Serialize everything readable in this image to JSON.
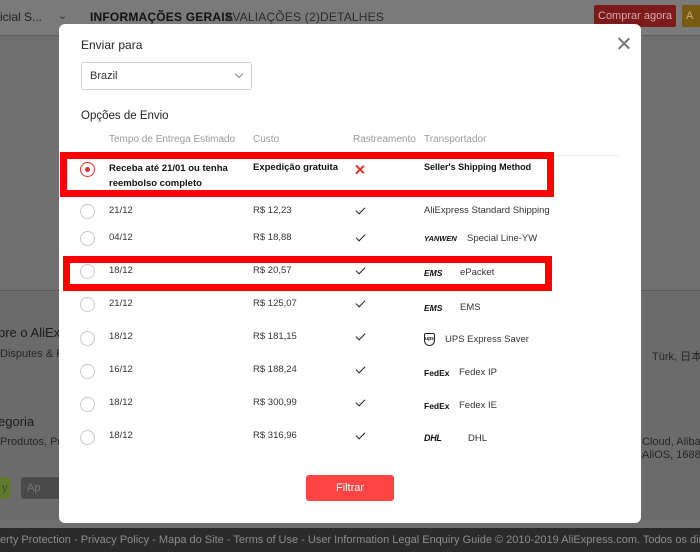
{
  "background": {
    "store_name": "icial S...",
    "tabs": [
      "INFORMAÇÕES GERAIS",
      "AVALIAÇÕES (2)",
      "DETALHES"
    ],
    "buy_button": "Comprar agora",
    "section_left_1": "bre o AliEx",
    "section_left_1_sub": "Disputes & Re",
    "section_right_1": "Türk, 日本語",
    "section_left_2": "egoria",
    "section_left_2_sub": "Produtos, Pro",
    "section_right_2a": "Cloud, Alibab",
    "section_right_2b": "AliOS, 1688,",
    "footer": "erty Protection - Privacy Policy - Mapa do Site - Terms of Use - User Information Legal Enquiry Guide © 2010-2019 AliExpress.com. Todos os direitos"
  },
  "modal": {
    "title": "Enviar para",
    "country": "Brazil",
    "section_title": "Opções de Envio",
    "headers": {
      "delivery": "Tempo de Entrega Estimado",
      "cost": "Custo",
      "tracking": "Rastreamento",
      "carrier": "Transportador"
    },
    "rows": [
      {
        "delivery": "Receba até 21/01 ou tenha reembolso completo",
        "cost": "Expedição gratuita",
        "tracking": false,
        "carrier": "Seller's Shipping Method",
        "logo": "",
        "selected": true
      },
      {
        "delivery": "21/12",
        "cost": "R$ 12,23",
        "tracking": true,
        "carrier": "AliExpress Standard Shipping",
        "logo": "",
        "selected": false
      },
      {
        "delivery": "04/12",
        "cost": "R$ 18,88",
        "tracking": true,
        "carrier": "Special Line-YW",
        "logo": "YANWEN",
        "selected": false
      },
      {
        "delivery": "18/12",
        "cost": "R$ 20,57",
        "tracking": true,
        "carrier": "ePacket",
        "logo": "EMS",
        "selected": false
      },
      {
        "delivery": "21/12",
        "cost": "R$ 125,07",
        "tracking": true,
        "carrier": "EMS",
        "logo": "EMS",
        "selected": false
      },
      {
        "delivery": "18/12",
        "cost": "R$ 181,15",
        "tracking": true,
        "carrier": "UPS Express Saver",
        "logo": "ups",
        "selected": false
      },
      {
        "delivery": "16/12",
        "cost": "R$ 188,24",
        "tracking": true,
        "carrier": "Fedex IP",
        "logo": "FedEx",
        "selected": false
      },
      {
        "delivery": "18/12",
        "cost": "R$ 300,99",
        "tracking": true,
        "carrier": "Fedex IE",
        "logo": "FedEx",
        "selected": false
      },
      {
        "delivery": "18/12",
        "cost": "R$ 316,96",
        "tracking": true,
        "carrier": "DHL",
        "logo": "DHL",
        "selected": false
      }
    ],
    "filter_button": "Filtrar"
  },
  "colors": {
    "accent": "#ff4444",
    "highlight": "#ff0000",
    "footer_bg": "#2b2b2b"
  }
}
